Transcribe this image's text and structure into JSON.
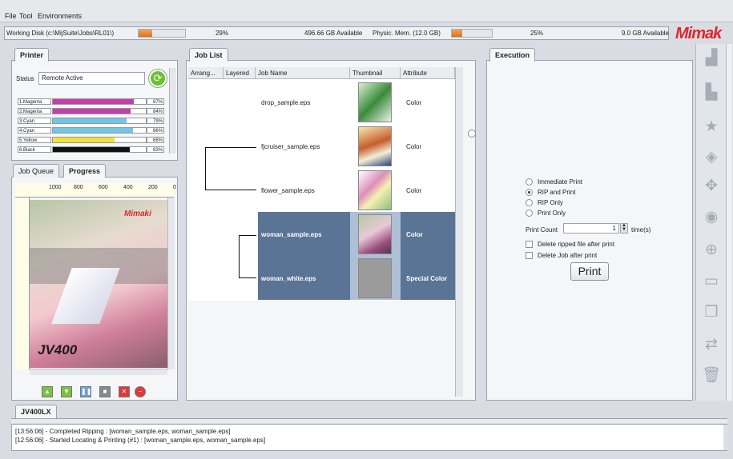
{
  "menu": [
    "File",
    "Tool",
    "Environments"
  ],
  "status_bar": {
    "working_disk_label": "Working Disk (c:\\MijSuite\\Jobs\\RL01\\)",
    "disk_percent": "29%",
    "disk_available": "496.66 GB Available",
    "memory_label": "Physic. Mem. (12.0 GB)",
    "mem_percent": "25%",
    "mem_available": "9.0 GB Available",
    "disk_fill": 0.29,
    "mem_fill": 0.25
  },
  "brand": "Mimak",
  "printer_panel": {
    "tab": "Printer",
    "status_label": "Status",
    "status_value": "Remote Active",
    "inks": [
      {
        "name": "1.Magenta",
        "percent": "87%",
        "level": 0.87,
        "color": "#c040a8"
      },
      {
        "name": "2.Magenta",
        "percent": "84%",
        "level": 0.84,
        "color": "#c040a8"
      },
      {
        "name": "3.Cyan",
        "percent": "79%",
        "level": 0.79,
        "color": "#6fc6e6"
      },
      {
        "name": "4.Cyan",
        "percent": "86%",
        "level": 0.86,
        "color": "#6fc6e6"
      },
      {
        "name": "5.Yellow",
        "percent": "66%",
        "level": 0.66,
        "color": "#f2e13b"
      },
      {
        "name": "6.Black",
        "percent": "83%",
        "level": 0.83,
        "color": "#111111"
      }
    ]
  },
  "queue_panel": {
    "tabs": [
      "Job Queue",
      "Progress"
    ],
    "ruler_labels": [
      "1000",
      "800",
      "600",
      "400",
      "200",
      "0"
    ],
    "preview_text": "JV400",
    "preview_brand": "Mimaki"
  },
  "job_list": {
    "tab": "Job List",
    "columns": [
      "Arrang...",
      "Layered",
      "Job Name",
      "Thumbnail",
      "Attribute"
    ],
    "jobs": [
      {
        "name": "drop_sample.eps",
        "attribute": "Color"
      },
      {
        "name": "fjcruiser_sample.eps",
        "attribute": "Color"
      },
      {
        "name": "flower_sample.eps",
        "attribute": "Color"
      },
      {
        "name": "woman_sample.eps",
        "attribute": "Color"
      },
      {
        "name": "woman_white.eps",
        "attribute": "Special Color"
      }
    ]
  },
  "execution": {
    "tab": "Execution",
    "options": [
      "Immediate Print",
      "RIP and Print",
      "RIP Only",
      "Print Only"
    ],
    "selected_option": "RIP and Print",
    "print_count_label": "Print Count",
    "print_count_value": "1",
    "times_label": "time(s)",
    "checkboxes": [
      "Delete ripped file after print",
      "Delete Job after print"
    ],
    "print_button": "Print"
  },
  "printer_tab": "JV400LX",
  "log": [
    "[13:56:06] - Completed Ripping : [woman_sample.eps, woman_sample.eps]",
    "[12:56:06] - Started Locating & Printing (#1) : [woman_sample.eps, woman_sample.eps]"
  ]
}
